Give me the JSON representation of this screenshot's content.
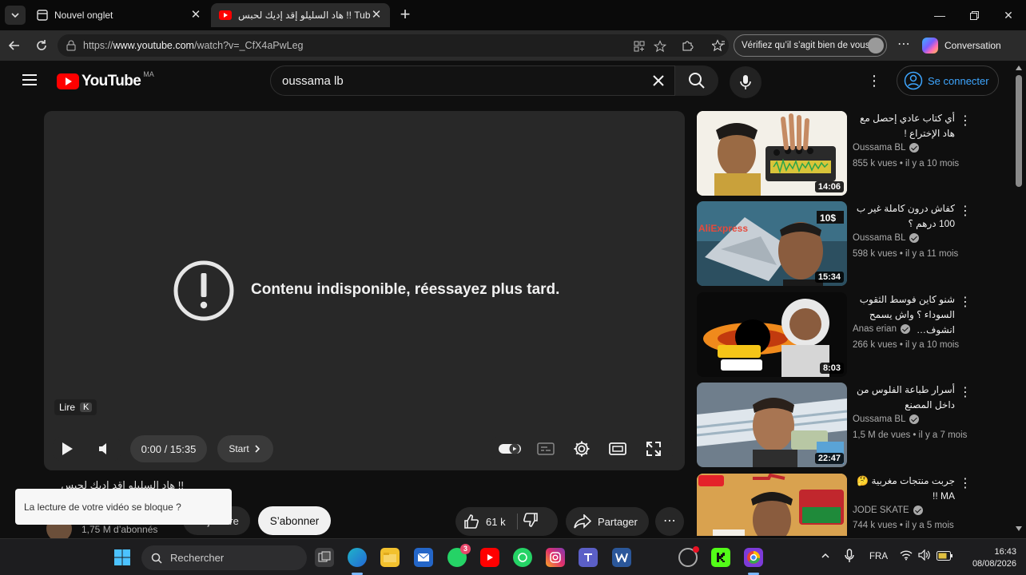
{
  "browser": {
    "tabs": [
      {
        "label": "Nouvel onglet"
      },
      {
        "label": "هاد السليلو إقد إديك لحبس !! Tube"
      }
    ],
    "url_prefix": "https://",
    "url_host": "www.youtube.com",
    "url_path": "/watch?v=_CfX4aPwLeg",
    "identity_prompt": "Vérifiez qu’il s’agit bien de vous",
    "copilot_label": "Conversation"
  },
  "youtube": {
    "logo_text": "YouTube",
    "country_code": "MA",
    "search_query": "oussama lb",
    "signin_label": "Se connecter"
  },
  "player": {
    "error_message": "Contenu indisponible, réessayez plus tard.",
    "tooltip_label": "Lire",
    "tooltip_key": "K",
    "time_display": "0:00 / 15:35",
    "chapter_label": "Start"
  },
  "video": {
    "title_partial": "!! هاد السليلو إقد إديك لحبس",
    "subscribers": "1,75 M d’abonnés",
    "join_label": "Rejoindre",
    "subscribe_label": "S’abonner",
    "likes": "61 k",
    "share_label": "Partager",
    "toast_message": "La lecture de votre vidéo se bloque ?"
  },
  "recommendations": [
    {
      "title": "أي كتاب عادي إحصل مع هاد الإختراع !",
      "channel": "Oussama BL",
      "verified": true,
      "views": "855 k vues",
      "age": "il y a 10 mois",
      "duration": "14:06"
    },
    {
      "title": "كفاش درون كاملة غير ب 100 درهم ؟",
      "channel": "Oussama BL",
      "verified": true,
      "views": "598 k vues",
      "age": "il y a 11 mois",
      "duration": "15:34"
    },
    {
      "title": "شنو كاين فوسط الثقوب السوداء ؟ واش يسمح انشوف…",
      "channel": "Anas erian",
      "verified": true,
      "views": "266 k vues",
      "age": "il y a 10 mois",
      "duration": "8:03"
    },
    {
      "title": "أسرار طباعة الفلوس من داخل المصنع",
      "channel": "Oussama BL",
      "verified": true,
      "views": "1,5 M de vues",
      "age": "il y a 7 mois",
      "duration": "22:47"
    },
    {
      "title": "جربت منتجات مغربية 🤔 MA !!",
      "channel": "JODE SKATE",
      "verified": true,
      "views": "744 k vues",
      "age": "il y a 5 mois",
      "duration": ""
    }
  ],
  "taskbar": {
    "search_label": "Rechercher",
    "language": "FRA",
    "time": "16:43",
    "date": "08/08/2026",
    "whatsapp_badge": "3"
  },
  "colors": {
    "accent_link": "#3ea6ff",
    "youtube_red": "#ff0000",
    "background": "#0f0f0f"
  },
  "icons": [
    "tab-list-icon",
    "youtube-favicon",
    "back-icon",
    "reload-icon",
    "site-info-icon",
    "hamburger-icon",
    "search-icon",
    "microphone-icon",
    "more-vert-icon",
    "account-icon",
    "error-icon",
    "play-icon",
    "volume-icon",
    "autoplay-toggle",
    "subtitles-icon",
    "settings-icon",
    "theater-icon",
    "fullscreen-icon",
    "like-icon",
    "dislike-icon",
    "share-icon",
    "windows-start-icon"
  ]
}
